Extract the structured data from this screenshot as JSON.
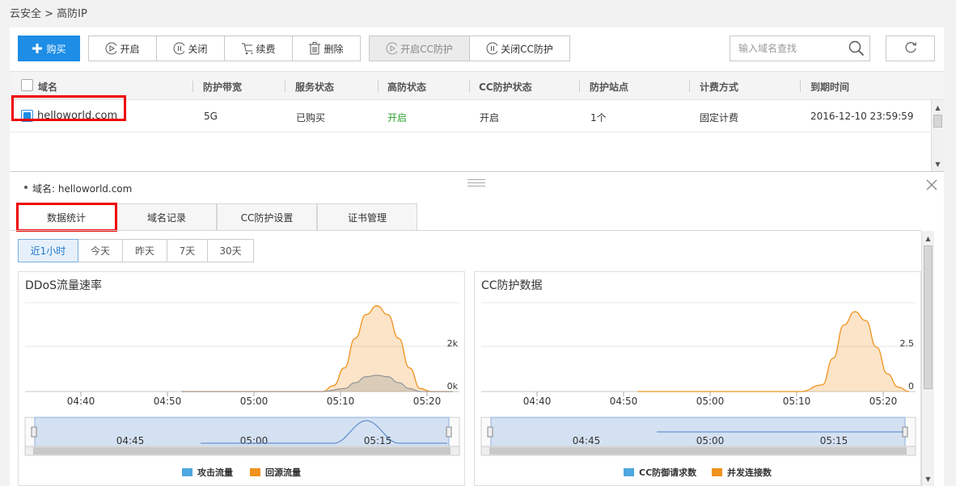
{
  "breadcrumb": "云安全 > 高防IP",
  "toolbar": {
    "buy": "购买",
    "enable": "开启",
    "disable": "关闭",
    "renew": "续费",
    "delete": "删除",
    "enable_cc": "开启CC防护",
    "disable_cc": "关闭CC防护",
    "search_placeholder": "输入域名查找"
  },
  "table": {
    "headers": [
      "域名",
      "防护带宽",
      "服务状态",
      "高防状态",
      "CC防护状态",
      "防护站点",
      "计费方式",
      "到期时间"
    ],
    "rows": [
      {
        "domain": "helloworld.com",
        "bandwidth": "5G",
        "service_status": "已购买",
        "ddos_status": "开启",
        "cc_status": "开启",
        "sites": "1个",
        "billing": "固定计费",
        "expiry": "2016-12-10 23:59:59"
      }
    ]
  },
  "detail": {
    "domain_label": "域名: helloworld.com",
    "tabs": [
      "数据统计",
      "域名记录",
      "CC防护设置",
      "证书管理"
    ],
    "active_tab": 0,
    "ranges": [
      "近1小时",
      "今天",
      "昨天",
      "7天",
      "30天"
    ],
    "active_range": 0
  },
  "colors": {
    "primary": "#1d8de6",
    "attack": "#4ea7e0",
    "origin": "#f0921e",
    "highlight": "#e00000"
  },
  "chart_data": [
    {
      "type": "area",
      "title": "DDoS流量速率",
      "x": [
        "04:40",
        "04:50",
        "05:00",
        "05:10",
        "05:20"
      ],
      "y_ticks": [
        "0k",
        "2k"
      ],
      "ylim": [
        0,
        3000
      ],
      "series": [
        {
          "name": "攻击流量",
          "points": [
            [
              0,
              0
            ],
            [
              5,
              0
            ],
            [
              10,
              0
            ],
            [
              15,
              0
            ],
            [
              20,
              0
            ],
            [
              25,
              0
            ],
            [
              28,
              0
            ],
            [
              30,
              100
            ],
            [
              31,
              300
            ],
            [
              32,
              500
            ],
            [
              33,
              550
            ],
            [
              34,
              500
            ],
            [
              35,
              300
            ],
            [
              36,
              100
            ],
            [
              37,
              0
            ],
            [
              40,
              0
            ]
          ]
        },
        {
          "name": "回源流量",
          "points": [
            [
              0,
              0
            ],
            [
              5,
              0
            ],
            [
              10,
              0
            ],
            [
              15,
              0
            ],
            [
              20,
              0
            ],
            [
              25,
              0
            ],
            [
              28,
              0
            ],
            [
              29,
              200
            ],
            [
              30,
              800
            ],
            [
              31,
              1800
            ],
            [
              32,
              2600
            ],
            [
              33,
              2900
            ],
            [
              34,
              2600
            ],
            [
              35,
              1800
            ],
            [
              36,
              800
            ],
            [
              37,
              100
            ],
            [
              38,
              0
            ],
            [
              40,
              0
            ]
          ]
        }
      ],
      "navigator_x": [
        "04:45",
        "05:00",
        "05:15"
      ],
      "legend": [
        "攻击流量",
        "回源流量"
      ]
    },
    {
      "type": "area",
      "title": "CC防护数据",
      "x": [
        "04:40",
        "04:50",
        "05:00",
        "05:10",
        "05:20"
      ],
      "y_ticks": [
        "0",
        "2.5"
      ],
      "ylim": [
        0,
        4
      ],
      "series": [
        {
          "name": "CC防御请求数",
          "points": [
            [
              0,
              0
            ],
            [
              40,
              0
            ]
          ]
        },
        {
          "name": "并发连接数",
          "points": [
            [
              0,
              0
            ],
            [
              5,
              0
            ],
            [
              10,
              0
            ],
            [
              15,
              0
            ],
            [
              20,
              0
            ],
            [
              25,
              0
            ],
            [
              30,
              0
            ],
            [
              32,
              0.3
            ],
            [
              33,
              1.5
            ],
            [
              34,
              3
            ],
            [
              35,
              3.6
            ],
            [
              36,
              3.2
            ],
            [
              37,
              2
            ],
            [
              38,
              0.8
            ],
            [
              39,
              0.2
            ],
            [
              40,
              0
            ]
          ]
        }
      ],
      "navigator_x": [
        "04:45",
        "05:00",
        "05:15"
      ],
      "legend": [
        "CC防御请求数",
        "并发连接数"
      ]
    }
  ]
}
